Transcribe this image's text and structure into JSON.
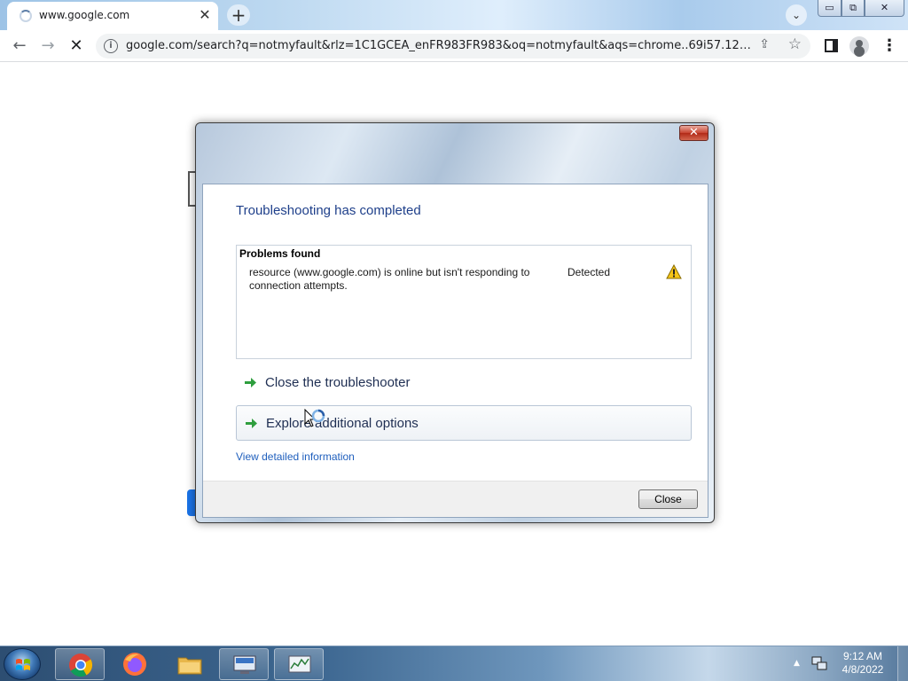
{
  "browser": {
    "tab_title": "www.google.com",
    "tab_close_glyph": "✕",
    "new_tab_glyph": "+",
    "tab_search_glyph": "⌄",
    "url": "google.com/search?q=notmyfault&rlz=1C1GCEA_enFR983FR983&oq=notmyfault&aqs=chrome..69i57.12630j0j...",
    "back_glyph": "←",
    "forward_glyph": "→",
    "stop_glyph": "✕",
    "info_glyph": "i",
    "share_glyph": "⇪",
    "star_glyph": "☆",
    "menu_glyph": "⋮",
    "window_controls": {
      "minimize": "▭",
      "maximize": "⧉",
      "close": "✕"
    }
  },
  "dialog": {
    "close_glyph": "✕",
    "heading": "Troubleshooting has completed",
    "problems": {
      "header": "Problems found",
      "items": [
        {
          "description": "resource (www.google.com) is online but isn't responding to connection attempts.",
          "status": "Detected",
          "icon": "warning-icon"
        }
      ]
    },
    "commands": {
      "close_troubleshooter": "Close the troubleshooter",
      "explore_options": "Explore additional options"
    },
    "detail_link": "View detailed information",
    "close_button": "Close"
  },
  "taskbar": {
    "clock_time": "9:12 AM",
    "clock_date": "4/8/2022",
    "tray_arrow": "▲",
    "apps": [
      "chrome-icon",
      "firefox-icon",
      "file-explorer-icon",
      "network-diagnostics-icon",
      "resource-monitor-icon"
    ]
  },
  "colors": {
    "dialog_heading": "#1e3f8a",
    "link": "#1f5fbd",
    "close_red": "#c7432f"
  }
}
